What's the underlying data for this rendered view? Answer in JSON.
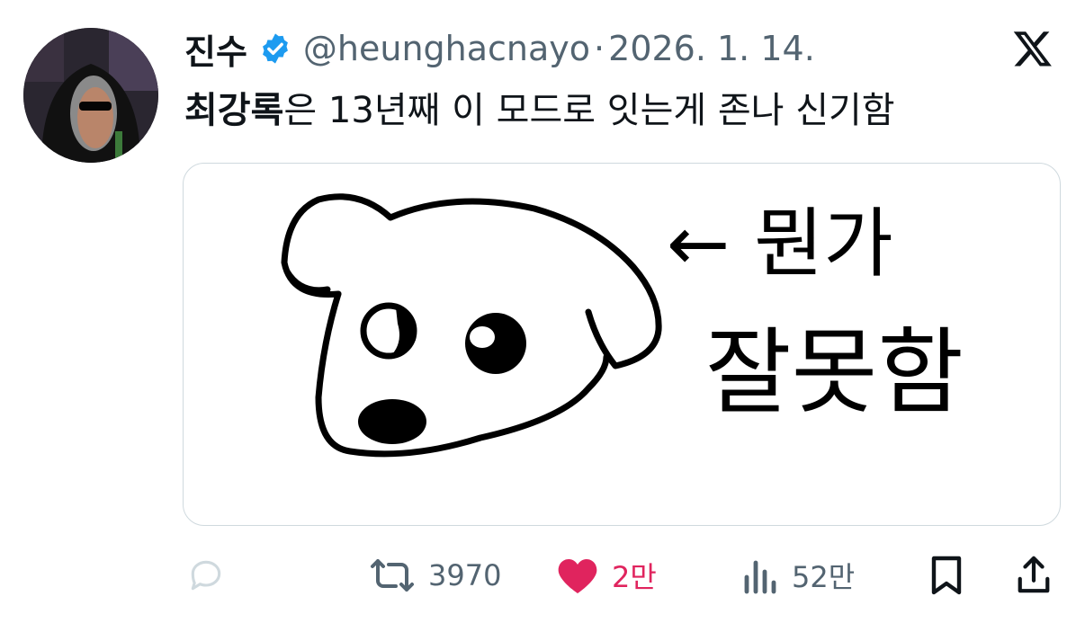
{
  "tweet": {
    "display_name": "진수",
    "handle": "@heunghacnayo",
    "separator": "·",
    "date": "2026. 1. 14.",
    "text_bold": "최강록",
    "text_rest": "은 13년째 이 모드로 잇는게 존나 신기함"
  },
  "media": {
    "caption_line1": "← 뭔가",
    "caption_line2": "잘못함"
  },
  "actions": {
    "retweets": "3970",
    "likes": "2만",
    "views": "52만"
  },
  "colors": {
    "verified": "#1d9bf0",
    "like": "#e0245e",
    "muted": "#536471",
    "text": "#0f1419"
  },
  "icons": [
    "avatar",
    "verified-badge-icon",
    "x-logo-icon",
    "reply-icon",
    "retweet-icon",
    "heart-icon",
    "views-icon",
    "bookmark-icon",
    "share-icon"
  ]
}
